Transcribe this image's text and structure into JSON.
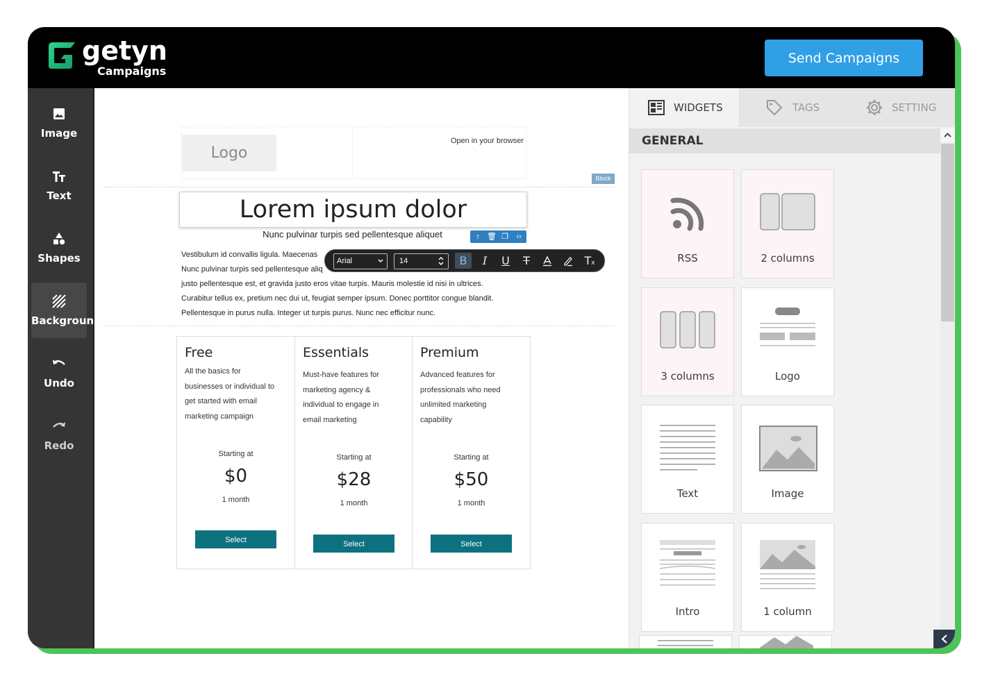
{
  "brand": {
    "name": "getyn",
    "sub": "Campaigns"
  },
  "header": {
    "send_label": "Send Campaigns"
  },
  "tools": [
    {
      "label": "Image",
      "icon": "image-icon"
    },
    {
      "label": "Text",
      "icon": "text-icon"
    },
    {
      "label": "Shapes",
      "icon": "shapes-icon"
    },
    {
      "label": "Background",
      "icon": "background-icon"
    },
    {
      "label": "Undo",
      "icon": "undo-icon"
    },
    {
      "label": "Redo",
      "icon": "redo-icon"
    }
  ],
  "canvas": {
    "logo": "Logo",
    "open_browser": "Open in your browser",
    "block_tag": "Block",
    "title": "Lorem ipsum dolor",
    "subtitle": "Nunc pulvinar turpis sed pellentesque aliquet",
    "para_lines": [
      "Vestibulum id convallis ligula. Maecenas",
      "Nunc pulvinar turpis sed pellentesque aliq",
      "justo pellentesque est, et gravida justo eros vitae turpis. Mauris molestie id nisi in ultrices.",
      "Curabitur tellus ex, pretium nec dui ut, feugiat semper ipsum. Donec porttitor congue blandit.",
      "Pellentesque in purus nulla. Integer ut turpis purus. Nunc nec efficitur nunc."
    ],
    "format_bar": {
      "font": "Arial",
      "size": "14"
    },
    "plans": [
      {
        "name": "Free",
        "desc": [
          "All the basics for",
          "businesses or individual to",
          "get started with email",
          "marketing campaign"
        ],
        "starting": "Starting at",
        "price": "$0",
        "period": "1 month",
        "button": "Select"
      },
      {
        "name": "Essentials",
        "desc": [
          "Must-have features for",
          "marketing agency &",
          "individual to engage in",
          "email marketing"
        ],
        "starting": "Starting at",
        "price": "$28",
        "period": "1 month",
        "button": "Select"
      },
      {
        "name": "Premium",
        "desc": [
          "Advanced features for",
          "professionals who need",
          "unlimited marketing",
          "capability"
        ],
        "starting": "Starting at",
        "price": "$50",
        "period": "1 month",
        "button": "Select"
      }
    ]
  },
  "panel": {
    "tabs": [
      "WIDGETS",
      "TAGS",
      "SETTING"
    ],
    "section": "GENERAL",
    "widgets": [
      "RSS",
      "2 columns",
      "3 columns",
      "Logo",
      "Text",
      "Image",
      "Intro",
      "1 column"
    ]
  },
  "colors": {
    "accent": "#2f9fe6",
    "select_button": "#0e7180",
    "frame": "#4cc45a"
  }
}
